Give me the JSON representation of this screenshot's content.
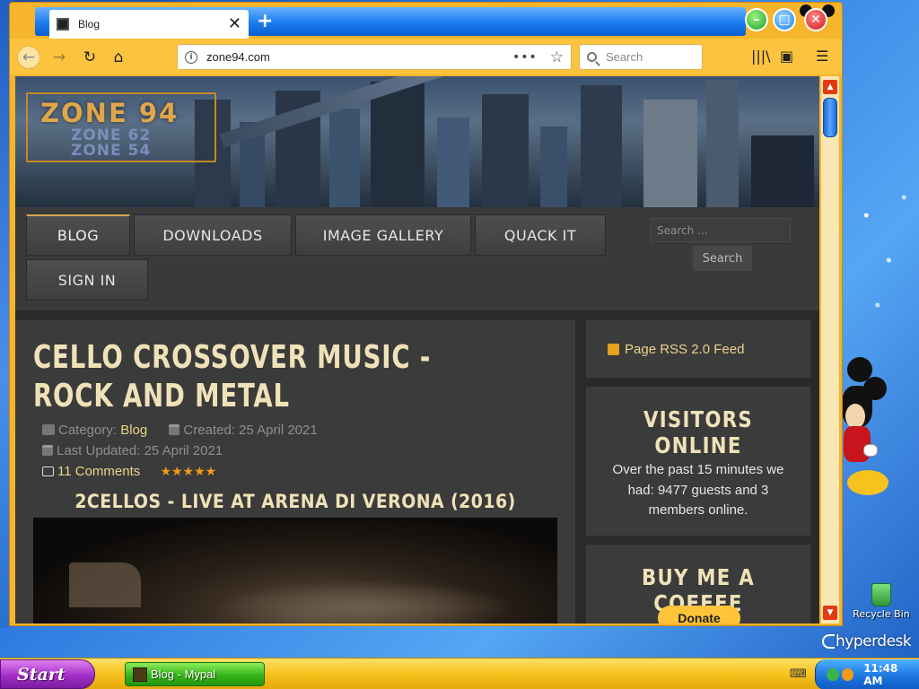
{
  "desktop": {
    "recycle_bin_label": "Recycle Bin",
    "brand": "hyperdesk"
  },
  "browser": {
    "tab_title": "Blog",
    "new_tab_symbol": "+",
    "address": "zone94.com",
    "page_actions": "•••",
    "search_placeholder": "Search"
  },
  "site": {
    "logo_main": "ZONE 94",
    "logo_sub_1": "ZONE 62",
    "logo_sub_2": "ZONE 54",
    "menu": [
      {
        "label": "BLOG",
        "active": true
      },
      {
        "label": "DOWNLOADS"
      },
      {
        "label": "IMAGE GALLERY"
      },
      {
        "label": "QUACK IT"
      },
      {
        "label": "SIGN IN"
      }
    ],
    "search_placeholder": "Search ...",
    "search_button": "Search"
  },
  "article": {
    "title": "CELLO CROSSOVER MUSIC - ROCK AND METAL",
    "category_label": "Category:",
    "category_value": "Blog",
    "created": "Created: 25 April 2021",
    "last_updated": "Last Updated: 25 April 2021",
    "comments": "11 Comments",
    "rating": 5,
    "rating_stars": "★★★★★",
    "video_title": "2CELLOS - LIVE AT ARENA DI VERONA (2016)"
  },
  "sidebar": {
    "rss_label": "Page RSS 2.0 Feed",
    "visitors_heading": "VISITORS ONLINE",
    "visitors_line1": "Over the past 15 minutes we had:",
    "visitors_line2": "9477 guests and 3 members online.",
    "coffee_heading": "BUY ME A COFFEE",
    "donate_label": "Donate"
  },
  "taskbar": {
    "start_label": "Start",
    "task_label": "Blog - Mypal",
    "clock": "11:48 AM"
  },
  "colors": {
    "window_frame": "#f6b52a",
    "tab_strip": "#1b7cf0",
    "taskbar": "#f7c21d",
    "start_button": "#a330c7",
    "task_button": "#36b419",
    "tray": "#1c76e0",
    "site_bg": "#3b3b3b",
    "heading": "#f0e2b8",
    "link": "#e8d48a",
    "rating": "#f39a1a",
    "donate": "#ffc439"
  }
}
